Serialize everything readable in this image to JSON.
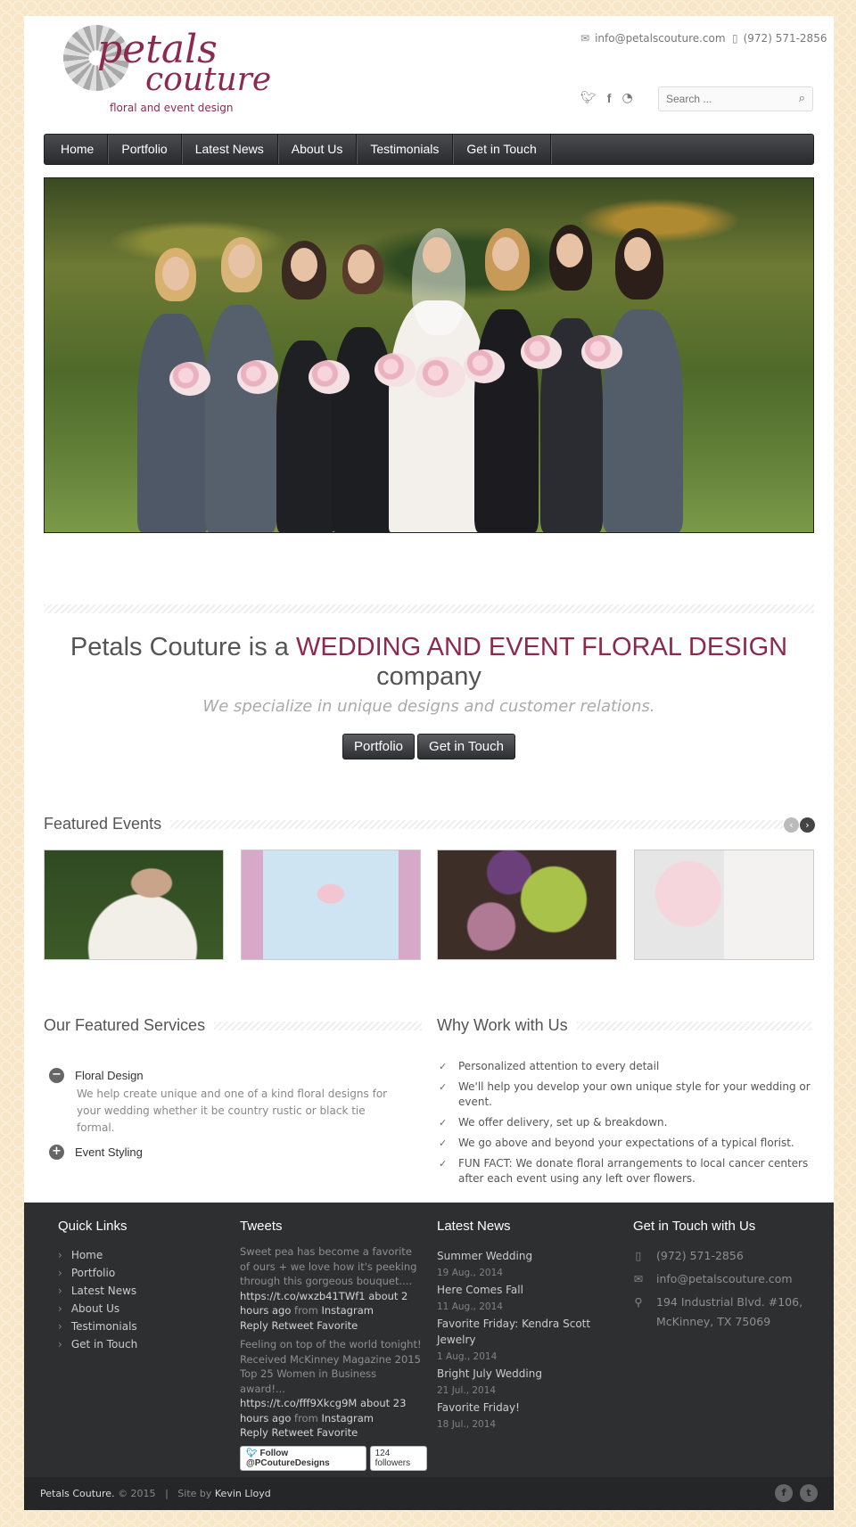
{
  "header": {
    "logo_word1": "petals",
    "logo_word2": "couture",
    "logo_tagline": "floral and event design",
    "email": "info@petalscouture.com",
    "phone": "(972) 571-2856",
    "search_placeholder": "Search ..."
  },
  "nav": {
    "items": [
      "Home",
      "Portfolio",
      "Latest News",
      "About Us",
      "Testimonials",
      "Get in Touch"
    ]
  },
  "intro": {
    "title_before": "Petals Couture is a ",
    "title_accent": "WEDDING AND EVENT FLORAL DESIGN",
    "title_after": " company",
    "subtitle": "We specialize in unique designs and customer relations.",
    "buttons": [
      "Portfolio",
      "Get in Touch"
    ]
  },
  "featured": {
    "heading": "Featured Events"
  },
  "services": {
    "heading": "Our Featured Services",
    "items": [
      {
        "title": "Floral Design",
        "description": "We help create unique and one of a kind floral designs for your wedding whether it be country rustic or black tie formal."
      },
      {
        "title": "Event Styling"
      }
    ]
  },
  "why": {
    "heading": "Why Work with Us",
    "items": [
      "Personalized attention to every detail",
      "We'll help you develop your own unique style for your wedding or event.",
      "We offer delivery, set up & breakdown.",
      "We go above and beyond your expectations of a typical florist.",
      "FUN FACT: We donate floral arrangements to local cancer centers after each event using any left over flowers."
    ]
  },
  "footer": {
    "quick_links": {
      "heading": "Quick Links",
      "items": [
        "Home",
        "Portfolio",
        "Latest News",
        "About Us",
        "Testimonials",
        "Get in Touch"
      ]
    },
    "tweets": {
      "heading": "Tweets",
      "items": [
        {
          "text": "Sweet pea has become a favorite of ours + we love how it's peeking through this gorgeous bouquet....",
          "link": "https://t.co/wxzb41TWf1",
          "time": "about 2 hours ago",
          "from": "from",
          "source": "Instagram",
          "actions": "Reply  Retweet  Favorite"
        },
        {
          "text": "Feeling on top of the world tonight! Received McKinney Magazine 2015 Top 25 Women in Business award!...",
          "link": "https://t.co/fff9Xkcg9M",
          "time": "about 23 hours ago",
          "from": "from",
          "source": "Instagram",
          "actions": "Reply  Retweet  Favorite"
        }
      ],
      "follow_label": "Follow @PCoutureDesigns",
      "followers": "124 followers"
    },
    "latest_news": {
      "heading": "Latest News",
      "items": [
        {
          "title": "Summer Wedding",
          "date": "19 Aug., 2014"
        },
        {
          "title": "Here Comes Fall",
          "date": "11 Aug., 2014"
        },
        {
          "title": "Favorite Friday: Kendra Scott Jewelry",
          "date": "1 Aug., 2014"
        },
        {
          "title": "Bright July Wedding",
          "date": "21 Jul., 2014"
        },
        {
          "title": "Favorite Friday!",
          "date": "18 Jul., 2014"
        }
      ]
    },
    "get_in_touch": {
      "heading": "Get in Touch with Us",
      "phone": "(972) 571-2856",
      "email": "info@petalscouture.com",
      "address_line1": "194 Industrial Blvd. #106,",
      "address_line2": "McKinney, TX 75069"
    },
    "copyright": {
      "brand": "Petals Couture.",
      "year": "© 2015",
      "separator": "|",
      "site_by": "Site by",
      "author": "Kevin Lloyd"
    }
  },
  "colors": {
    "accent": "#8c2a4e",
    "nav_bg": "#3a3b3e",
    "footer_bg": "#2d2f31",
    "page_bg": "#f7e7c8"
  }
}
